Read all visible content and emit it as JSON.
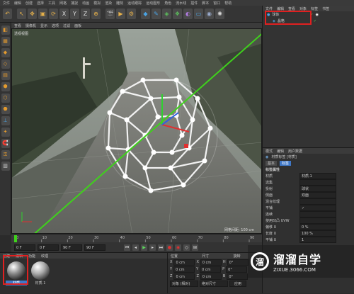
{
  "menu": {
    "items": [
      "文件",
      "编辑",
      "创建",
      "选择",
      "工具",
      "网格",
      "捕捉",
      "动画",
      "模拟",
      "渲染",
      "雕刻",
      "运动跟踪",
      "运动图形",
      "角色",
      "流水线",
      "插件",
      "脚本",
      "窗口",
      "帮助"
    ]
  },
  "toolbar": {
    "axis_x": "X",
    "axis_y": "Y",
    "axis_z": "Z"
  },
  "viewport": {
    "menu": [
      "查看",
      "摄像机",
      "显示",
      "选项",
      "过滤",
      "面板"
    ],
    "label": "透视视图",
    "grid_info": "网格间距: 100 cm",
    "accent_line": "#3fd11c"
  },
  "timeline": {
    "ticks": [
      "0",
      "10",
      "20",
      "30",
      "40",
      "50",
      "60",
      "70",
      "80",
      "90"
    ],
    "frame_end": "90 F"
  },
  "transport": {
    "frame_current": "0 F",
    "frame_start": "0 F",
    "frame_end": "90 F",
    "frame_max": "90 F"
  },
  "materials": {
    "menu": [
      "创建",
      "编辑",
      "功能",
      "纹理"
    ],
    "items": [
      {
        "label": "材质"
      },
      {
        "label": "材质.1"
      }
    ]
  },
  "coords": {
    "headers": [
      "位置",
      "尺寸",
      "旋转"
    ],
    "rows": [
      {
        "axis": "X",
        "pos": "0 cm",
        "size": "0 cm",
        "rot_label": "H",
        "rot": "0°"
      },
      {
        "axis": "Y",
        "pos": "0 cm",
        "size": "0 cm",
        "rot_label": "P",
        "rot": "0°"
      },
      {
        "axis": "Z",
        "pos": "0 cm",
        "size": "0 cm",
        "rot_label": "B",
        "rot": "0°"
      }
    ],
    "mode": "对象 (相对)",
    "size_mode": "绝对尺寸",
    "apply": "应用"
  },
  "objects": {
    "tabs": [
      "文件",
      "编辑",
      "查看",
      "对象",
      "标签",
      "书签"
    ],
    "rows": [
      {
        "label": "球体"
      },
      {
        "label": "晶格"
      }
    ]
  },
  "attributes": {
    "tabs": [
      "模式",
      "编辑",
      "用户数据"
    ],
    "title": "材质标签 [材质]",
    "tab_basic": "基本",
    "tab_tag": "标签",
    "section": "标签属性",
    "rows": [
      {
        "label": "材质",
        "value": "材质.1"
      },
      {
        "label": "选集",
        "value": ""
      },
      {
        "label": "投射",
        "value": "球状"
      },
      {
        "label": "侧面",
        "value": "双面"
      },
      {
        "label": "混合纹理",
        "value": ""
      },
      {
        "label": "平铺",
        "value": "✓"
      },
      {
        "label": "连续",
        "value": ""
      },
      {
        "label": "使用凹凸 UVW",
        "value": ""
      },
      {
        "label": "偏移 U",
        "value": "0 %"
      },
      {
        "label": "长度 U",
        "value": "100 %"
      },
      {
        "label": "平铺 U",
        "value": "1"
      }
    ]
  },
  "watermark": {
    "logo": "溜",
    "title": "溜溜自学",
    "url": "ZIXUE.3066.COM"
  }
}
